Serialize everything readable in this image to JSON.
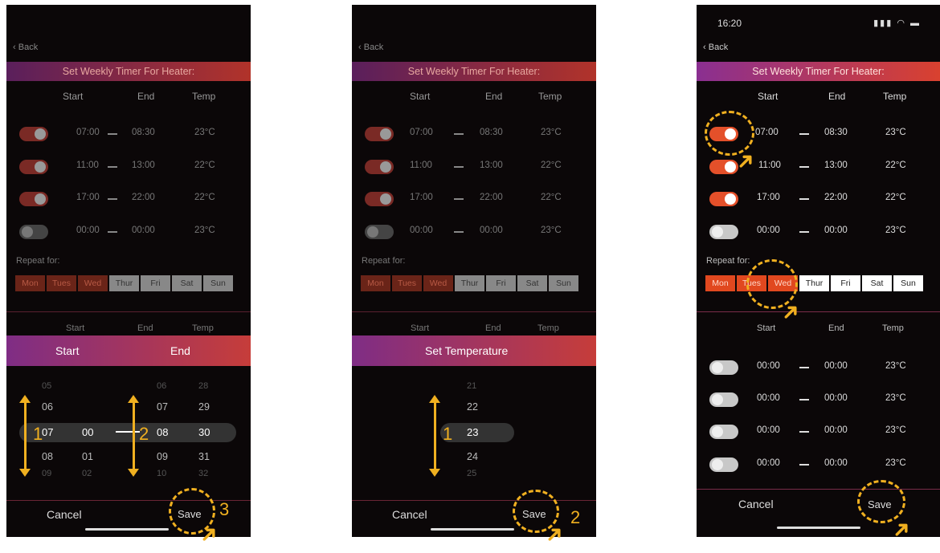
{
  "common": {
    "back": "Back",
    "title": "Set Weekly Timer For Heater:",
    "col_start": "Start",
    "col_end": "End",
    "col_temp": "Temp",
    "repeat_label": "Repeat for:",
    "cancel": "Cancel",
    "save": "Save",
    "days": [
      "Mon",
      "Tues",
      "Wed",
      "Thur",
      "Fri",
      "Sat",
      "Sun"
    ]
  },
  "timers": [
    {
      "start": "07:00",
      "end": "08:30",
      "temp": "23°C",
      "on": true
    },
    {
      "start": "11:00",
      "end": "13:00",
      "temp": "22°C",
      "on": true
    },
    {
      "start": "17:00",
      "end": "22:00",
      "temp": "22°C",
      "on": true
    },
    {
      "start": "00:00",
      "end": "00:00",
      "temp": "23°C",
      "on": false
    }
  ],
  "timers_second": [
    {
      "start": "00:00",
      "end": "00:00",
      "temp": "23°C",
      "on": false
    },
    {
      "start": "00:00",
      "end": "00:00",
      "temp": "23°C",
      "on": false
    },
    {
      "start": "00:00",
      "end": "00:00",
      "temp": "23°C",
      "on": false
    },
    {
      "start": "00:00",
      "end": "00:00",
      "temp": "23°C",
      "on": false
    }
  ],
  "selected_days": [
    "Mon",
    "Tues",
    "Wed"
  ],
  "screen1": {
    "picker_start": "Start",
    "picker_end": "End",
    "start_hours": [
      "05",
      "06",
      "07",
      "08",
      "09"
    ],
    "start_minutes": [
      "",
      "",
      "00",
      "01",
      "02"
    ],
    "end_hours": [
      "06",
      "07",
      "08",
      "09",
      "10"
    ],
    "end_minutes": [
      "28",
      "29",
      "30",
      "31",
      "32"
    ],
    "step_labels": [
      "1",
      "2",
      "3"
    ]
  },
  "screen2": {
    "picker_title": "Set Temperature",
    "temps": [
      "21",
      "22",
      "23",
      "24",
      "25"
    ],
    "step_labels": [
      "1",
      "2"
    ]
  },
  "screen3": {
    "time": "16:20",
    "status_icons": "signal-wifi-battery"
  },
  "colors": {
    "accent": "#f0b020",
    "gradient_start": "#8a2f91",
    "gradient_end": "#d9412f",
    "toggle_on": "#e4502a"
  }
}
